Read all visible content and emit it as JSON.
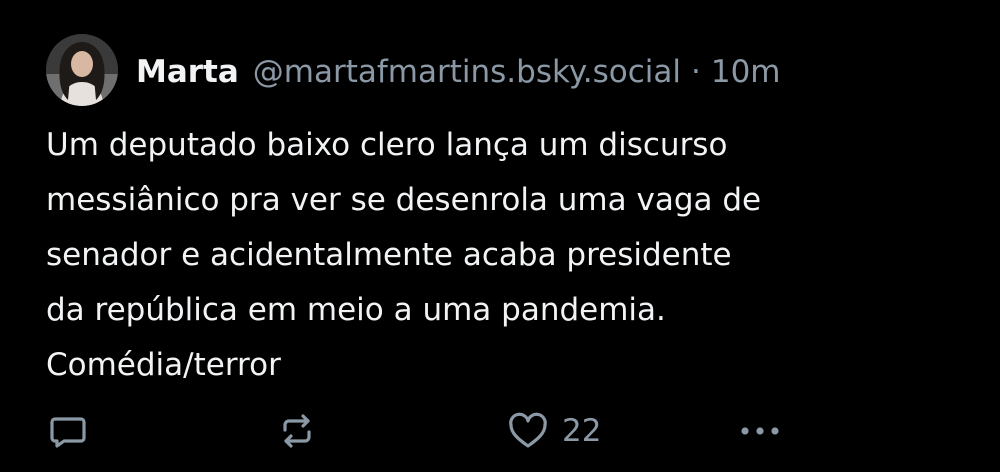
{
  "post": {
    "author": {
      "display_name": "Marta",
      "handle": "@martafmartins.bsky.social"
    },
    "separator": "·",
    "time": "10m",
    "text_lines": [
      "Um deputado baixo clero lança um discurso",
      "messiânico pra ver se desenrola uma vaga de",
      "senador e acidentalmente acaba presidente",
      "da república em meio a uma pandemia.",
      "Comédia/terror"
    ],
    "actions": {
      "reply_icon": "reply-bubble-icon",
      "repost_icon": "repost-arrows-icon",
      "like_icon": "heart-outline-icon",
      "like_count": "22",
      "more_icon": "ellipsis-icon"
    }
  },
  "colors": {
    "background": "#000000",
    "text_primary": "#f1f3f5",
    "text_secondary": "#8b98a5"
  }
}
